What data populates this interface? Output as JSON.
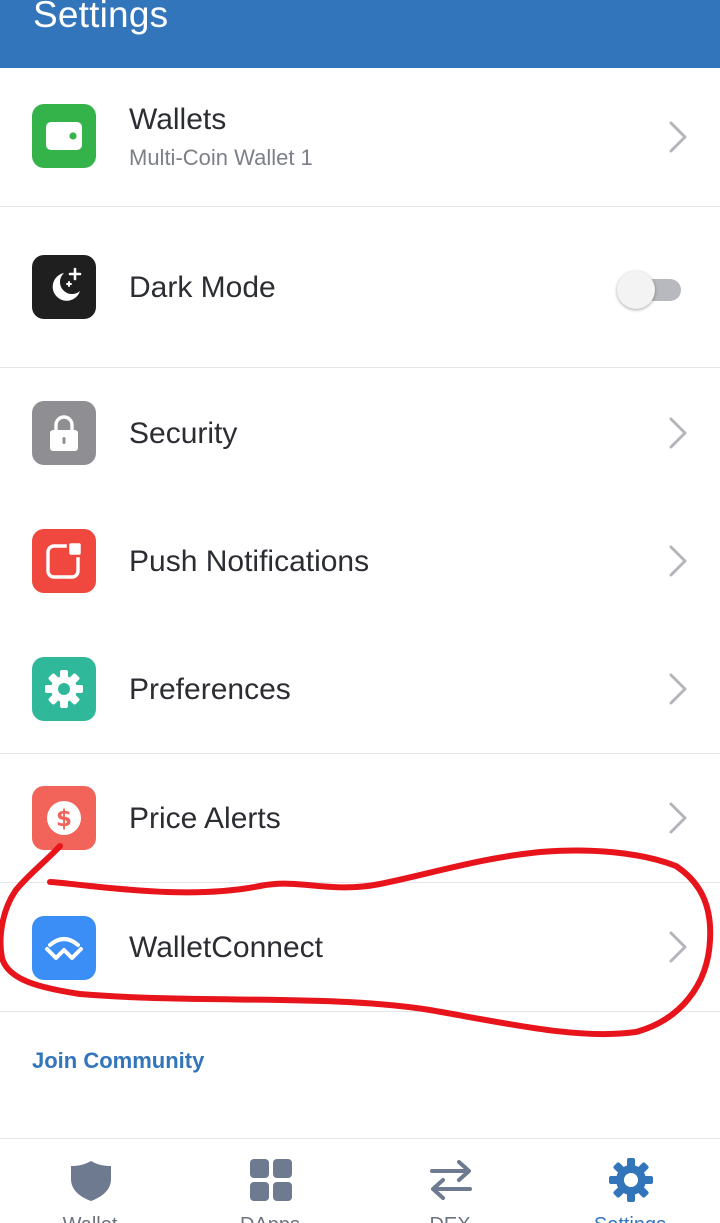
{
  "header": {
    "title": "Settings"
  },
  "rows": {
    "wallets": {
      "label": "Wallets",
      "sublabel": "Multi-Coin Wallet 1",
      "icon": "wallet-icon",
      "color": "#34b34a"
    },
    "dark_mode": {
      "label": "Dark Mode",
      "icon": "moon-stars-icon",
      "color": "#1f1f1f",
      "toggle_on": false
    },
    "security": {
      "label": "Security",
      "icon": "lock-icon",
      "color": "#8e8e93"
    },
    "push_notifications": {
      "label": "Push Notifications",
      "icon": "notification-icon",
      "color": "#f0473e"
    },
    "preferences": {
      "label": "Preferences",
      "icon": "gear-icon",
      "color": "#2fb89a"
    },
    "price_alerts": {
      "label": "Price Alerts",
      "icon": "dollar-icon",
      "color": "#f26359"
    },
    "walletconnect": {
      "label": "WalletConnect",
      "icon": "walletconnect-icon",
      "color": "#3a8ef6"
    }
  },
  "join_community": {
    "label": "Join Community"
  },
  "bottom_nav": {
    "items": [
      {
        "label": "Wallet",
        "icon": "shield-icon",
        "active": false
      },
      {
        "label": "DApps",
        "icon": "grid-icon",
        "active": false
      },
      {
        "label": "DEX",
        "icon": "swap-arrows-icon",
        "active": false
      },
      {
        "label": "Settings",
        "icon": "gear-icon",
        "active": true
      }
    ]
  },
  "colors": {
    "header": "#3375bb",
    "accent": "#3375bb",
    "annotation": "#e8141b"
  }
}
